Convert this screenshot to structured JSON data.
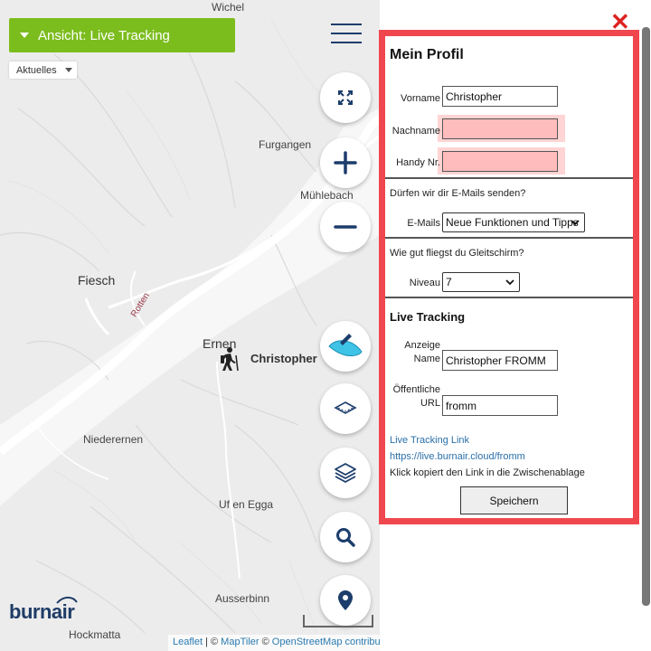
{
  "map": {
    "places": [
      "Wichel",
      "Furgangen",
      "Mühlebach",
      "Fiesch",
      "Ernen",
      "Niederernen",
      "Uf en Egga",
      "Ausserbinn",
      "Hockmatta"
    ],
    "river_label": "Rotten",
    "marker_name": "Christopher",
    "brand": "burnair",
    "attribution": {
      "leaflet": "Leaflet",
      "sep1": " | © ",
      "maptiler": "MapTiler",
      "sep2": " © ",
      "osm": "OpenStreetMap contributors"
    }
  },
  "toolbar": {
    "view_select": "Ansicht: Live Tracking",
    "aktuelles": "Aktuelles"
  },
  "map_buttons": {
    "icons": [
      "fullscreen-icon",
      "zoom-in-icon",
      "zoom-out-icon",
      "paraglider-icon",
      "layer-outline-icon",
      "layers-icon",
      "search-icon",
      "location-pin-icon"
    ],
    "colors": {
      "primary": "#1c3d6b",
      "accent_green": "#7cbd1e",
      "panel_border": "#f0474e",
      "paraglider": "#3ec3e6"
    }
  },
  "profile": {
    "title": "Mein Profil",
    "vorname_label": "Vorname",
    "vorname_value": "Christopher",
    "nachname_label": "Nachname",
    "nachname_value": "",
    "handy_label": "Handy Nr.",
    "handy_value": "",
    "email_question": "Dürfen wir dir E-Mails senden?",
    "emails_label": "E-Mails",
    "emails_selected": "Neue Funktionen und Tipps",
    "skill_question": "Wie gut fliegst du Gleitschirm?",
    "niveau_label": "Niveau",
    "niveau_selected": "7",
    "live_title": "Live Tracking",
    "anzeige_label_1": "Anzeige",
    "anzeige_label_2": "Name",
    "anzeige_value": "Christopher FROMM",
    "url_label_1": "Öffentliche",
    "url_label_2": "URL",
    "url_value": "fromm",
    "link_title": "Live Tracking Link",
    "link_url": "https://live.burnair.cloud/fromm",
    "copy_hint": "Klick kopiert den Link in die Zwischenablage",
    "save_label": "Speichern"
  }
}
